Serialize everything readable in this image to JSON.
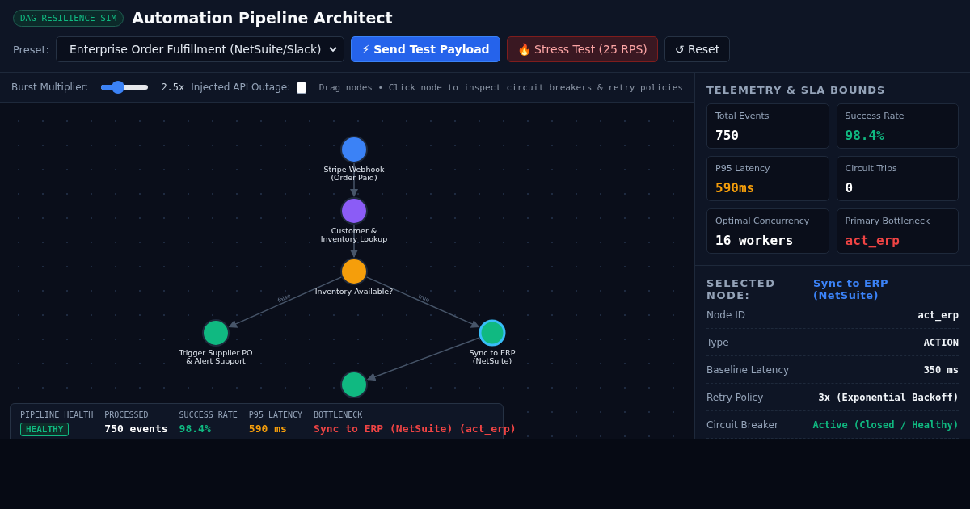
{
  "header": {
    "badge": "DAG RESILIENCE SIM",
    "title": "Automation Pipeline Architect"
  },
  "controls": {
    "preset_label": "Preset:",
    "preset_value": "Enterprise Order Fulfillment (NetSuite/Slack)",
    "buttons": [
      {
        "kind": "primary",
        "icon": "⚡",
        "label": "Send Test Payload"
      },
      {
        "kind": "danger",
        "icon": "🔥",
        "label": "Stress Test (25 RPS)"
      },
      {
        "kind": "plain",
        "icon": "↺",
        "label": "Reset"
      }
    ]
  },
  "toolbar": {
    "burst_label": "Burst Multiplier:",
    "burst": {
      "level": 0.35
    },
    "burst_reading": "2.5x",
    "outage_label": "Injected API Outage:",
    "outage_checked": false,
    "hint": "Drag nodes • Click node to inspect circuit breakers & retry policies"
  },
  "graph": {
    "nodes": [
      {
        "lines": [
          "Stripe Webhook",
          "(Order Paid)"
        ],
        "color": "#3b82f6",
        "selected": false
      },
      {
        "lines": [
          "Customer &",
          "Inventory Lookup"
        ],
        "color": "#8b5cf6",
        "selected": false
      },
      {
        "lines": [
          "Inventory Available?"
        ],
        "color": "#f59e0b",
        "selected": false
      },
      {
        "lines": [
          "Trigger Supplier PO",
          "& Alert Support"
        ],
        "color": "#10b981",
        "selected": false
      },
      {
        "lines": [
          "Sync to ERP",
          "(NetSuite)"
        ],
        "color": "#10b981",
        "selected": true
      },
      {
        "color": "#10b981",
        "selected": false
      }
    ],
    "branch_labels": [
      "false",
      "true"
    ]
  },
  "summary": [
    {
      "heading": "PIPELINE HEALTH",
      "value": "HEALTHY",
      "kind": "badge",
      "color": "#10b981"
    },
    {
      "heading": "PROCESSED",
      "value": "750 events",
      "kind": "text",
      "color": "#ffffff"
    },
    {
      "heading": "SUCCESS RATE",
      "value": "98.4%",
      "kind": "text",
      "color": "#10b981"
    },
    {
      "heading": "P95 LATENCY",
      "value": "590 ms",
      "kind": "text",
      "color": "#f59e0b"
    },
    {
      "heading": "BOTTLENECK",
      "value": "Sync to ERP (NetSuite) (act_erp)",
      "kind": "text",
      "color": "#ef4444"
    }
  ],
  "telemetry": {
    "title": "TELEMETRY & SLA BOUNDS",
    "cards": [
      {
        "label": "Total Events",
        "value": "750",
        "color": "#ffffff"
      },
      {
        "label": "Success Rate",
        "value": "98.4%",
        "color": "#10b981"
      },
      {
        "label": "P95 Latency",
        "value": "590ms",
        "color": "#f59e0b"
      },
      {
        "label": "Circuit Trips",
        "value": "0",
        "color": "#ffffff"
      },
      {
        "label": "Optimal Concurrency",
        "value": "16 workers",
        "color": "#ffffff"
      },
      {
        "label": "Primary Bottleneck",
        "value": "act_erp",
        "color": "#ef4444"
      }
    ]
  },
  "selected_node": {
    "title": "SELECTED NODE:",
    "name": "Sync to ERP (NetSuite)",
    "rows": [
      {
        "key": "Node ID",
        "value": "act_erp",
        "kind": "text"
      },
      {
        "key": "Type",
        "value": "ACTION",
        "kind": "text"
      },
      {
        "key": "Baseline Latency",
        "value": "350 ms",
        "kind": "text"
      },
      {
        "key": "Retry Policy",
        "value": "3x (Exponential Backoff)",
        "kind": "text"
      },
      {
        "key": "Circuit Breaker",
        "value": "Active (Closed / Healthy)",
        "kind": "status"
      }
    ]
  }
}
